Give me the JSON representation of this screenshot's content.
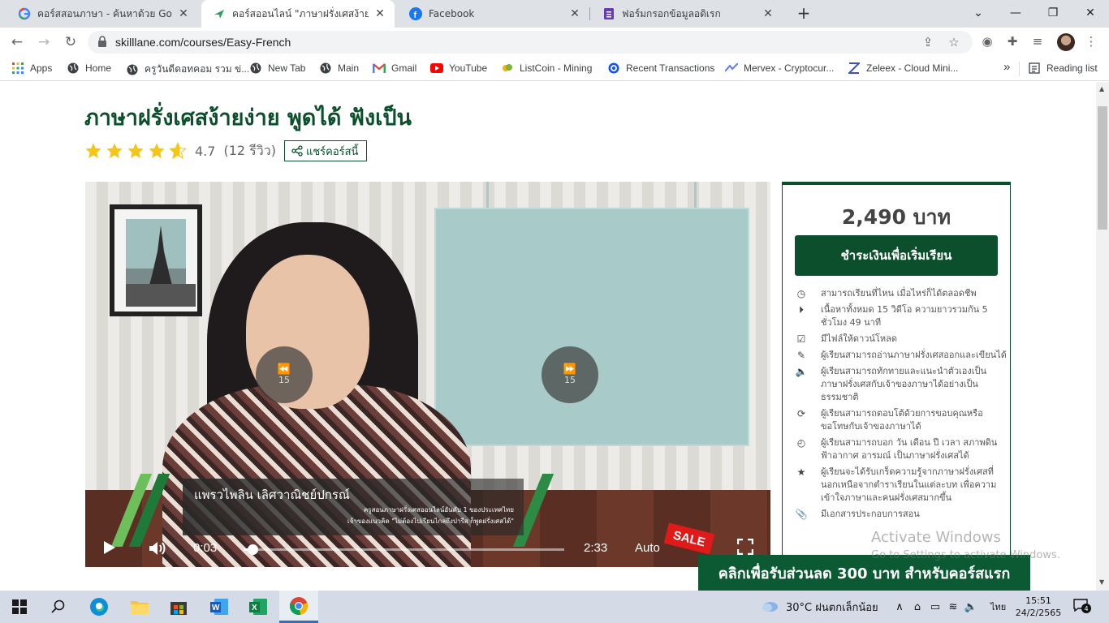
{
  "browser": {
    "tabs": [
      {
        "title": "คอร์สสอนภาษา - ค้นหาด้วย Google",
        "icon": "google-icon",
        "active": false
      },
      {
        "title": "คอร์สออนไลน์ \"ภาษาฝรั่งเศสง้ายง่าย พู",
        "icon": "skilllane-icon",
        "active": true
      },
      {
        "title": "Facebook",
        "icon": "facebook-icon",
        "active": false
      },
      {
        "title": "ฟอร์มกรอกข้อมูลอดิเรก",
        "icon": "forms-icon",
        "active": false
      }
    ],
    "url": "skilllane.com/courses/Easy-French",
    "bookmarks": [
      {
        "label": "Apps",
        "icon": "apps-grid-icon"
      },
      {
        "label": "Home",
        "icon": "globe-icon"
      },
      {
        "label": "ครูวันดีดอทคอม รวม ข่...",
        "icon": "globe-icon"
      },
      {
        "label": "New Tab",
        "icon": "globe-icon"
      },
      {
        "label": "Main",
        "icon": "globe-icon"
      },
      {
        "label": "Gmail",
        "icon": "gmail-icon"
      },
      {
        "label": "YouTube",
        "icon": "youtube-icon"
      },
      {
        "label": "ListCoin - Mining",
        "icon": "listcoin-icon"
      },
      {
        "label": "Recent Transactions",
        "icon": "coinbase-icon"
      },
      {
        "label": "Mervex - Cryptocur...",
        "icon": "mervex-icon"
      },
      {
        "label": "Zeleex - Cloud Mini...",
        "icon": "zeleex-icon"
      }
    ],
    "bookmarks_more": "»",
    "reading_list": "Reading list"
  },
  "course": {
    "title": "ภาษาฝรั่งเศสง้ายง่าย พูดได้ ฟังเป็น",
    "rating": 4.7,
    "rating_text": "4.7",
    "review_count": "(12 รีวิว)",
    "share_label": "แชร์คอร์สนี้"
  },
  "video": {
    "presenter_name": "แพรวไพลิน เลิศวาณิชย์ปกรณ์",
    "presenter_line1": "ครูสอนภาษาฝรั่งเศสออนไลน์อันดับ 1 ของประเทศไทย",
    "presenter_line2": "เจ้าของแนวคิด \"ไม่ต้องไปเรียนไกลถึงปารีส ก็พูดฝรั่งเศสได้\"",
    "rewind_label": "15",
    "forward_label": "15",
    "current_time": "0:03",
    "duration": "2:33",
    "progress": 0.02,
    "quality": "Auto",
    "sale_badge": "SALE"
  },
  "sidebar": {
    "price": "2,490 บาท",
    "pay_button": "ชำระเงินเพื่อเริ่มเรียน",
    "features": [
      {
        "icon": "clock-icon",
        "text": "สามารถเรียนที่ไหน เมื่อไหร่ก็ได้ตลอดชีพ"
      },
      {
        "icon": "play-circle-icon",
        "text": "เนื้อหาทั้งหมด 15 วิดีโอ ความยาวรวมกัน 5 ชั่วโมง 49 นาที"
      },
      {
        "icon": "checkbox-icon",
        "text": "มีไฟล์ให้ดาวน์โหลด"
      },
      {
        "icon": "pencil-icon",
        "text": "ผู้เรียนสามารถอ่านภาษาฝรั่งเศสออกและเขียนได้"
      },
      {
        "icon": "speaker-icon",
        "text": "ผู้เรียนสามารถทักทายและแนะนำตัวเองเป็นภาษาฝรั่งเศสกับเจ้าของภาษาได้อย่างเป็นธรรมชาติ"
      },
      {
        "icon": "refresh-icon",
        "text": "ผู้เรียนสามารถตอบโต้ด้วยการขอบคุณหรือขอโทษกับเจ้าของภาษาได้"
      },
      {
        "icon": "clock-small-icon",
        "text": "ผู้เรียนสามารถบอก วัน เดือน ปี เวลา สภาพดินฟ้าอากาศ อารมณ์ เป็นภาษาฝรั่งเศสได้"
      },
      {
        "icon": "star-icon",
        "text": "ผู้เรียนจะได้รับเกร็ดความรู้จากภาษาฝรั่งเศสที่นอกเหนือจากตำราเรียนในแต่ละบท เพื่อความเข้าใจภาษาและคนฝรั่งเศสมากขึ้น"
      },
      {
        "icon": "paperclip-icon",
        "text": "มีเอกสารประกอบการสอน"
      }
    ]
  },
  "promo": "คลิกเพื่อรับส่วนลด 300 บาท สำหรับคอร์สแรก",
  "watermark": {
    "line1": "Activate Windows",
    "line2": "Go to Settings to activate Windows."
  },
  "taskbar": {
    "weather": "30°C ฝนตกเล็กน้อย",
    "language": "ไทย",
    "time": "15:51",
    "date": "24/2/2565",
    "notifications": "4"
  },
  "colors": {
    "brand_green": "#0b4f2c",
    "star_yellow": "#f5c518",
    "sale_red": "#e01919"
  }
}
